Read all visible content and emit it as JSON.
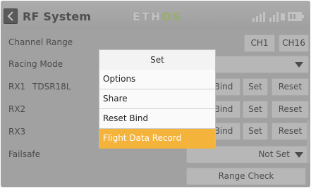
{
  "header": {
    "title": "RF System",
    "brand": {
      "part1": "ETH",
      "part2": "OS"
    },
    "status_icons": [
      "signal-bars-icon",
      "rssi-icon",
      "battery-icon"
    ]
  },
  "rows": {
    "channel_range": {
      "label": "Channel Range",
      "ch_start": "CH1",
      "ch_end": "CH16"
    },
    "racing_mode": {
      "label": "Racing Mode"
    },
    "rx1": {
      "label": "RX1",
      "name": "TDSR18L",
      "bind": "Bind",
      "set": "Set",
      "reset": "Reset"
    },
    "rx2": {
      "label": "RX2",
      "bind": "Bind",
      "set": "Set",
      "reset": "Reset"
    },
    "rx3": {
      "label": "RX3",
      "bind": "Bind",
      "set": "Set",
      "reset": "Reset"
    },
    "failsafe": {
      "label": "Failsafe",
      "value": "Not Set"
    },
    "range_check": {
      "label": "Range Check"
    }
  },
  "dialog": {
    "title": "Set",
    "items": [
      "Options",
      "Share",
      "Reset Bind",
      "Flight Data Record"
    ],
    "selected_index": 3
  },
  "colors": {
    "accent_orange": "#f4b33a",
    "brand_green": "#b7dd6b",
    "back_button": "#4a4a4a"
  }
}
